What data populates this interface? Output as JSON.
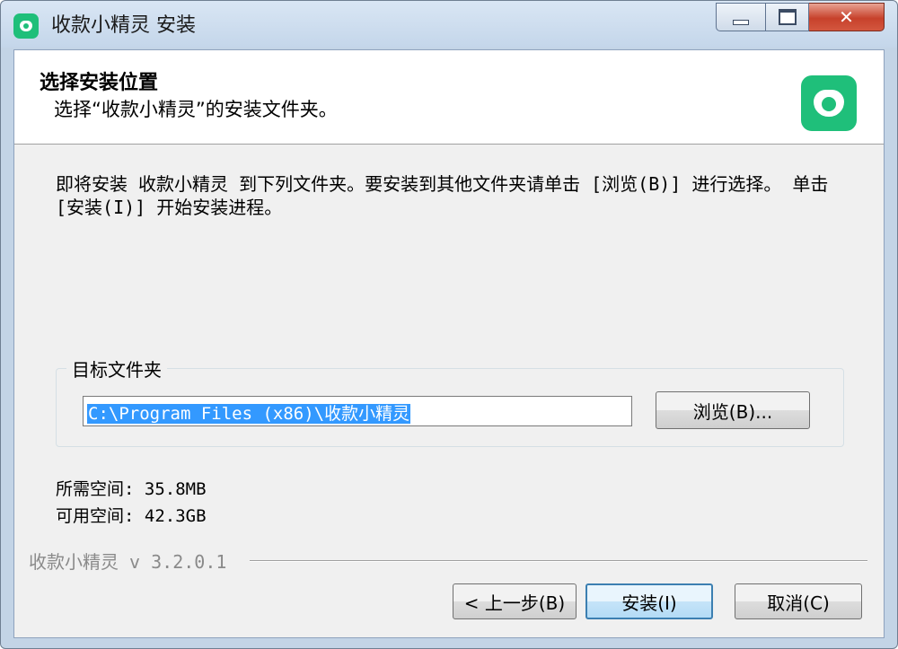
{
  "window": {
    "title": "收款小精灵 安装",
    "minimize_glyph": "",
    "maximize_glyph": "",
    "close_glyph": "✕"
  },
  "header": {
    "title": "选择安装位置",
    "subtitle": "选择“收款小精灵”的安装文件夹。"
  },
  "body": {
    "description": "即将安装 收款小精灵 到下列文件夹。要安装到其他文件夹请单击 [浏览(B)] 进行选择。 单击 [安装(I)] 开始安装进程。"
  },
  "target_folder": {
    "group_label": "目标文件夹",
    "path": "C:\\Program Files (x86)\\收款小精灵",
    "browse_label": "浏览(B)..."
  },
  "space": {
    "required": "所需空间: 35.8MB",
    "available": "可用空间: 42.3GB"
  },
  "footer": {
    "version": "收款小精灵 v 3.2.0.1",
    "back_label": "< 上一步(B)",
    "install_label": "安装(I)",
    "cancel_label": "取消(C)"
  },
  "colors": {
    "brand_green": "#1fbf7a",
    "selection_blue": "#3399ff",
    "close_red": "#c7412b"
  },
  "icons": {
    "app_icon": "app-logo-icon",
    "header_logo": "app-logo-icon"
  }
}
